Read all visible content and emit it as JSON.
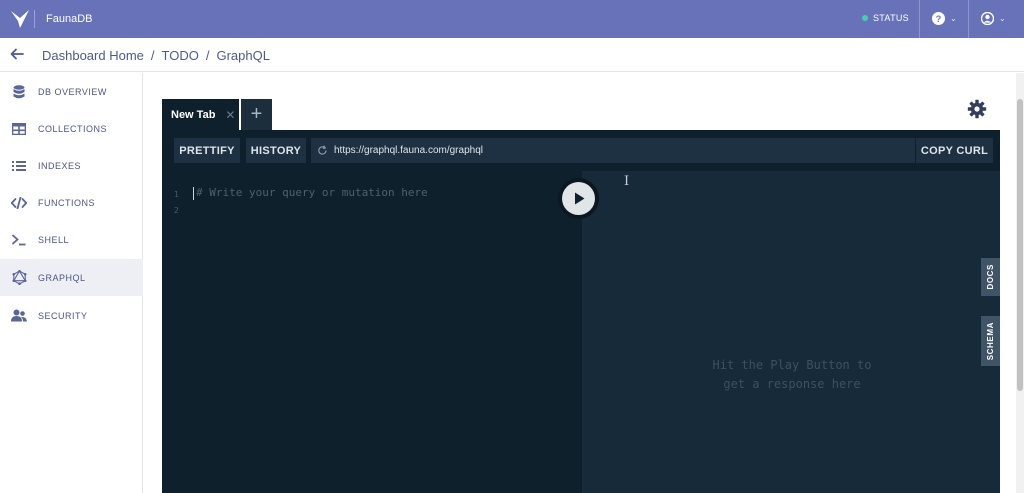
{
  "app": {
    "brand": "FaunaDB",
    "accent": "#6772b8"
  },
  "topbar": {
    "status_label": "STATUS",
    "status_color": "#3ad7a4"
  },
  "breadcrumb": {
    "items": [
      "Dashboard Home",
      "TODO",
      "GraphQL"
    ],
    "separator": "/"
  },
  "sidebar": {
    "items": [
      {
        "label": "DB OVERVIEW",
        "icon": "database-icon",
        "active": false
      },
      {
        "label": "COLLECTIONS",
        "icon": "table-icon",
        "active": false
      },
      {
        "label": "INDEXES",
        "icon": "list-icon",
        "active": false
      },
      {
        "label": "FUNCTIONS",
        "icon": "code-icon",
        "active": false
      },
      {
        "label": "SHELL",
        "icon": "terminal-icon",
        "active": false
      },
      {
        "label": "GRAPHQL",
        "icon": "graphql-icon",
        "active": true
      },
      {
        "label": "SECURITY",
        "icon": "users-icon",
        "active": false
      }
    ]
  },
  "playground": {
    "tab_label": "New Tab",
    "add_tab": "+",
    "prettify": "PRETTIFY",
    "history": "HISTORY",
    "endpoint_url": "https://graphql.fauna.com/graphql",
    "copy_curl": "COPY CURL",
    "line_numbers": [
      "1",
      "2"
    ],
    "editor_placeholder": "# Write your query or mutation here",
    "result_hint_line1": "Hit the Play Button to",
    "result_hint_line2": "get a response here",
    "docs_tab": "DOCS",
    "schema_tab": "SCHEMA"
  }
}
